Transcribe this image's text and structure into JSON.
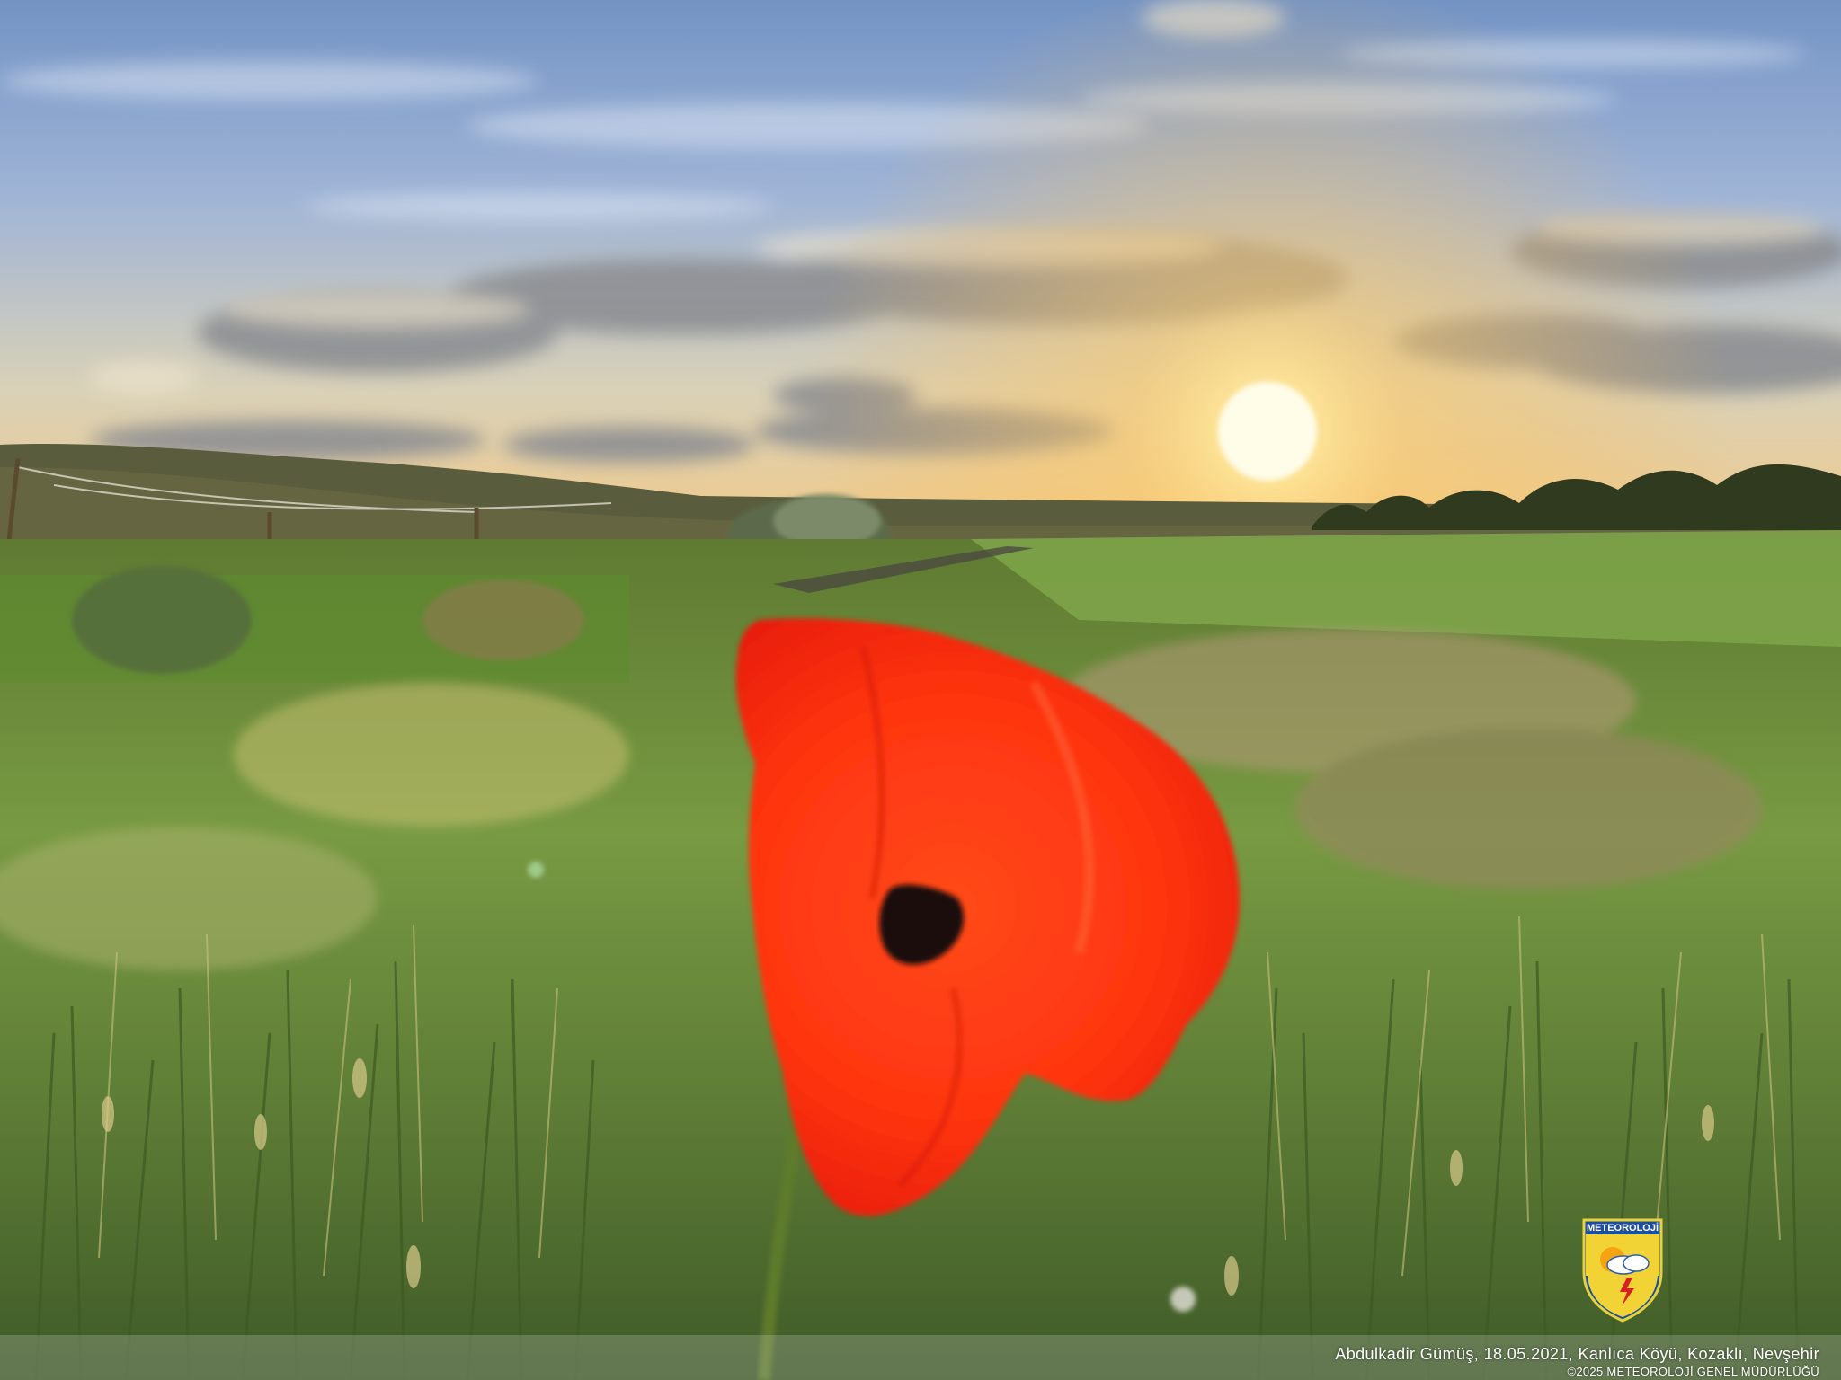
{
  "photo": {
    "subject": "red-poppy",
    "scene": "sunset-grassland"
  },
  "caption": {
    "credit": "Abdulkadir Gümüş, 18.05.2021, Kanlıca Köyü, Kozaklı, Nevşehir",
    "copyright": "©2025 METEOROLOJİ GENEL MÜDÜRLÜĞÜ"
  },
  "logo": {
    "text": "METEOROLOJİ",
    "icon": "meteoroloji-shield-icon"
  },
  "colors": {
    "sky_top": "#7f9ccb",
    "sky_horizon": "#f3d8a0",
    "sun": "#fff6c8",
    "grass": "#6f8c3c",
    "poppy": "#ff3a12",
    "poppy_center": "#1c0a08"
  }
}
